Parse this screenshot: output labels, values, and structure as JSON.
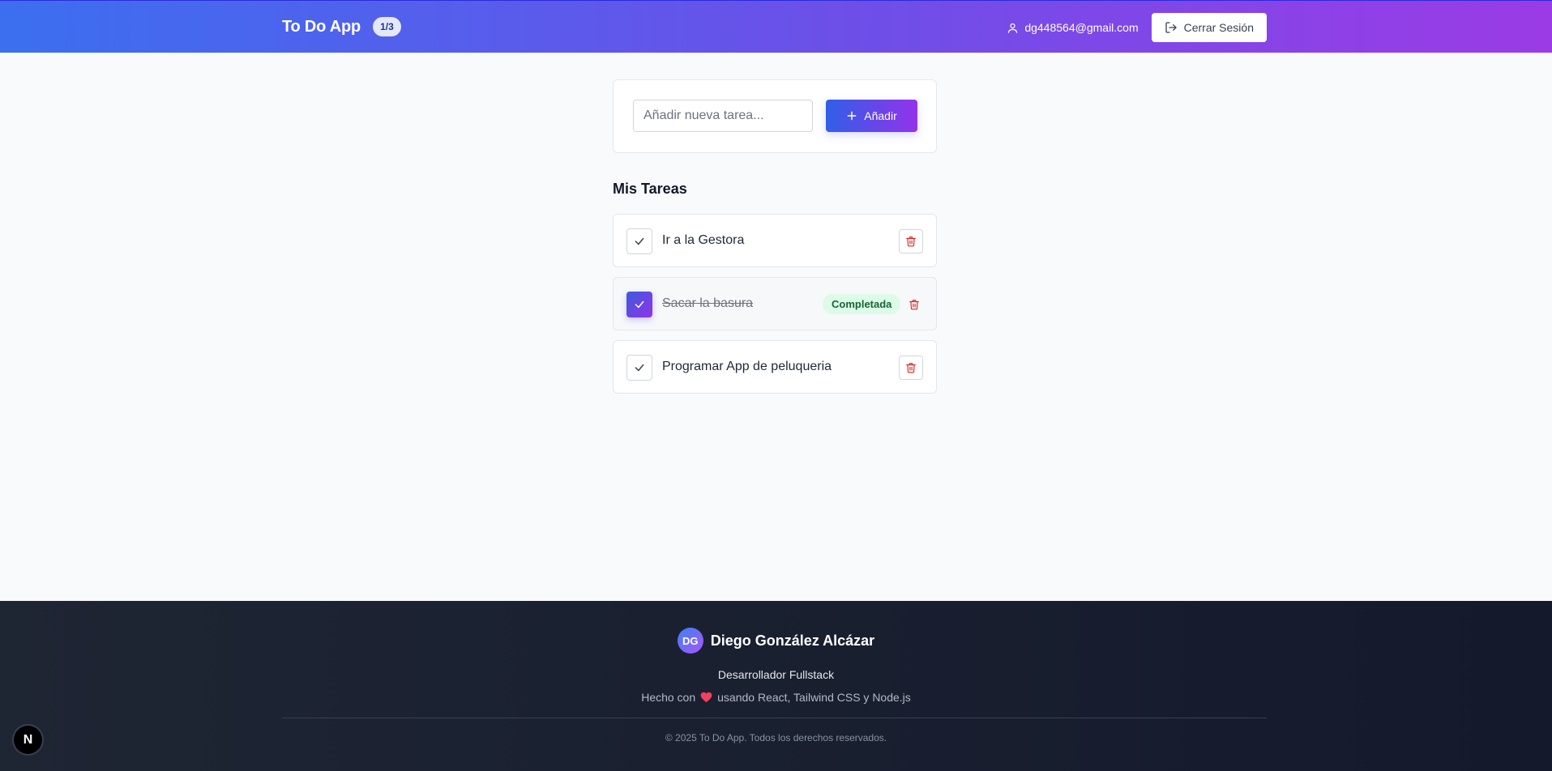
{
  "header": {
    "title": "To Do App",
    "counter": "1/3",
    "user_email": "dg448564@gmail.com",
    "logout_label": "Cerrar Sesión"
  },
  "add_task": {
    "placeholder": "Añadir nueva tarea...",
    "value": "",
    "button_label": "Añadir"
  },
  "tasks_section": {
    "title": "Mis Tareas",
    "items": [
      {
        "label": "Ir a la Gestora",
        "completed": false
      },
      {
        "label": "Sacar la basura",
        "completed": true,
        "badge": "Completada"
      },
      {
        "label": "Programar App de peluqueria",
        "completed": false
      }
    ]
  },
  "footer": {
    "initials": "DG",
    "author_name": "Diego González Alcázar",
    "role": "Desarrollador Fullstack",
    "made_with_prefix": "Hecho con",
    "made_with_suffix": "usando React, Tailwind CSS y Node.js",
    "copyright": "© 2025 To Do App. Todos los derechos reservados."
  },
  "dev_badge": {
    "label": "N"
  },
  "colors": {
    "header_gradient_start": "#3b6ff0",
    "header_gradient_end": "#9b3be6",
    "delete_icon": "#dc2626",
    "completed_badge_bg": "#dcfce7",
    "completed_badge_text": "#166534",
    "heart": "#f43f5e"
  },
  "icons": {
    "user": "user-icon",
    "logout": "logout-icon",
    "add": "plus-icon",
    "check": "check-icon",
    "delete": "trash-icon",
    "heart": "heart-icon"
  }
}
